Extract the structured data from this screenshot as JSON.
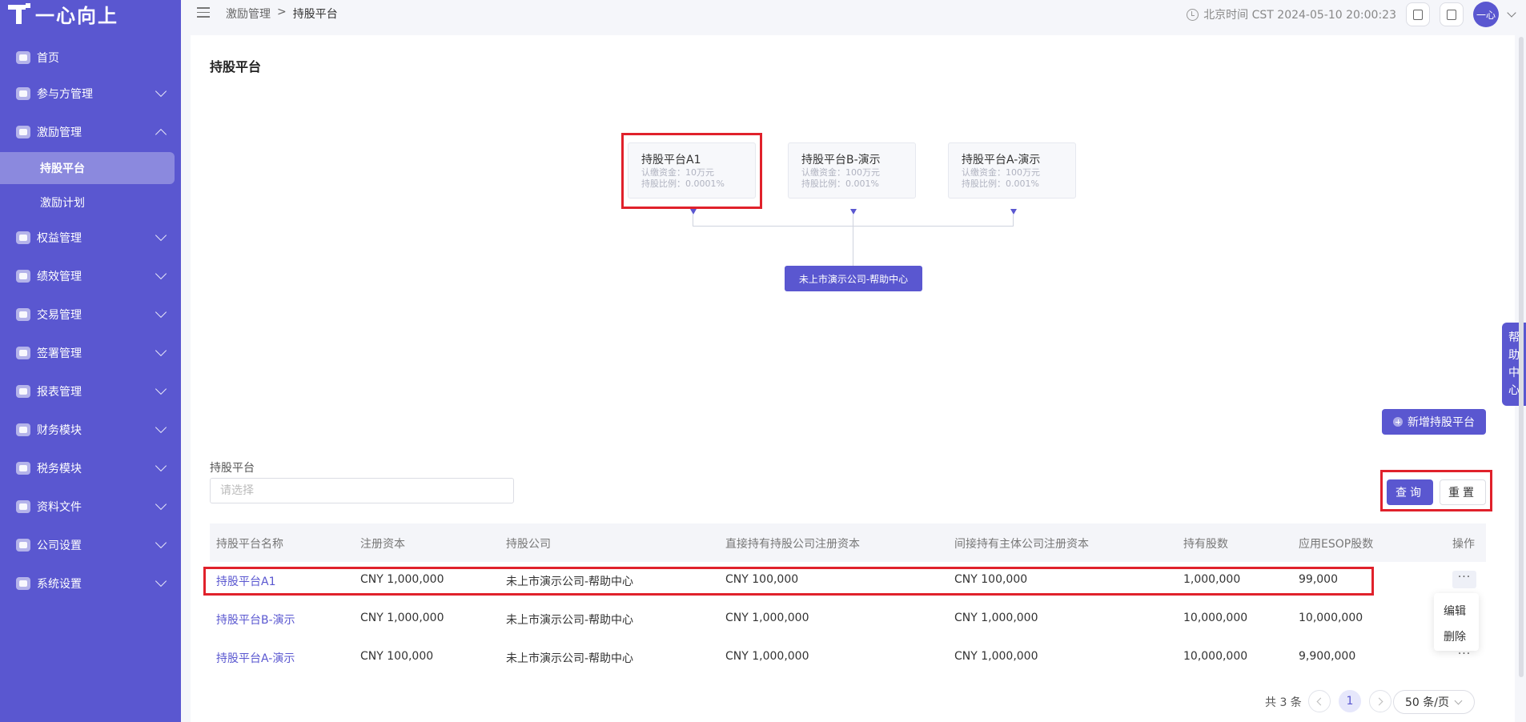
{
  "app": {
    "logo_text": "一心向上"
  },
  "sidebar": {
    "items": [
      {
        "label": "首页"
      },
      {
        "label": "参与方管理"
      },
      {
        "label": "激励管理"
      },
      {
        "label": "权益管理"
      },
      {
        "label": "绩效管理"
      },
      {
        "label": "交易管理"
      },
      {
        "label": "签署管理"
      },
      {
        "label": "报表管理"
      },
      {
        "label": "财务模块"
      },
      {
        "label": "税务模块"
      },
      {
        "label": "资料文件"
      },
      {
        "label": "公司设置"
      },
      {
        "label": "系统设置"
      }
    ],
    "sub_items": [
      {
        "label": "持股平台"
      },
      {
        "label": "激励计划"
      }
    ]
  },
  "header": {
    "breadcrumb": [
      "激励管理",
      ">",
      "持股平台"
    ],
    "time_text": "北京时间 CST 2024-05-10 20:00:23",
    "avatar_text": "一心"
  },
  "page": {
    "title": "持股平台",
    "chart": {
      "nodes": [
        {
          "title": "持股平台A1",
          "capital": "认缴资金：10万元",
          "ratio": "持股比例：0.0001%"
        },
        {
          "title": "持股平台B-演示",
          "capital": "认缴资金：100万元",
          "ratio": "持股比例：0.001%"
        },
        {
          "title": "持股平台A-演示",
          "capital": "认缴资金：100万元",
          "ratio": "持股比例：0.001%"
        }
      ],
      "root": "未上市演示公司-帮助中心"
    },
    "add_button": "新增持股平台",
    "filter": {
      "label": "持股平台",
      "placeholder": "请选择"
    },
    "query_button": "查询",
    "reset_button": "重置",
    "table": {
      "headers": [
        "持股平台名称",
        "注册资本",
        "持股公司",
        "直接持有持股公司注册资本",
        "间接持有主体公司注册资本",
        "持有股数",
        "应用ESOP股数",
        "操作"
      ],
      "rows": [
        [
          "持股平台A1",
          "CNY 1,000,000",
          "未上市演示公司-帮助中心",
          "CNY 100,000",
          "CNY 100,000",
          "1,000,000",
          "99,000"
        ],
        [
          "持股平台B-演示",
          "CNY 1,000,000",
          "未上市演示公司-帮助中心",
          "CNY 1,000,000",
          "CNY 1,000,000",
          "10,000,000",
          "10,000,000"
        ],
        [
          "持股平台A-演示",
          "CNY 100,000",
          "未上市演示公司-帮助中心",
          "CNY 1,000,000",
          "CNY 1,000,000",
          "10,000,000",
          "9,900,000"
        ]
      ],
      "more_glyph": "···"
    },
    "row_menu": [
      "编辑",
      "删除"
    ],
    "pagination": {
      "total": "共 3 条",
      "current": "1",
      "page_size": "50 条/页"
    }
  },
  "help_tab": [
    "帮",
    "助",
    "中",
    "心"
  ],
  "colors": {
    "accent": "#5a57d0",
    "highlight": "#e0212b"
  }
}
